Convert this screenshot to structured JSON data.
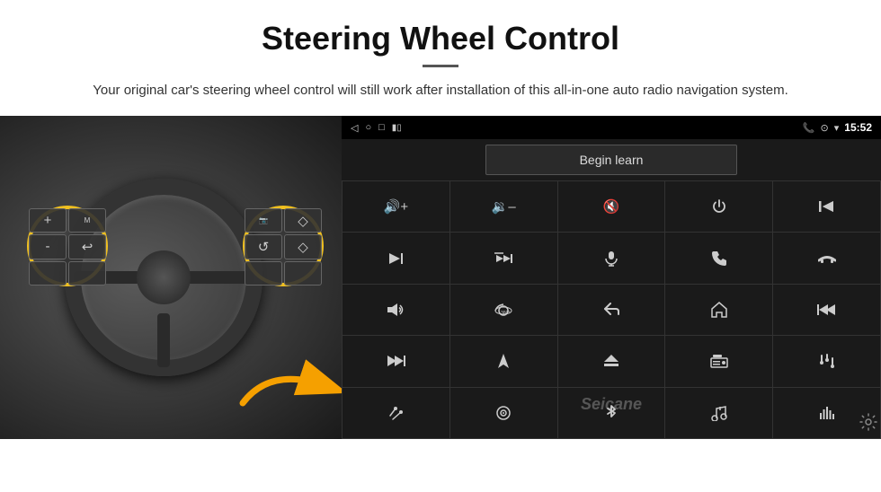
{
  "header": {
    "title": "Steering Wheel Control",
    "subtitle": "Your original car's steering wheel control will still work after installation of this all-in-one auto radio navigation system."
  },
  "status_bar": {
    "time": "15:52",
    "icons": [
      "◁",
      "○",
      "□",
      "📶"
    ]
  },
  "begin_learn": {
    "label": "Begin learn"
  },
  "controls": [
    {
      "icon": "🔊+",
      "label": "vol-up"
    },
    {
      "icon": "🔊-",
      "label": "vol-down"
    },
    {
      "icon": "🔇",
      "label": "mute"
    },
    {
      "icon": "⏻",
      "label": "power"
    },
    {
      "icon": "⏮",
      "label": "prev-track"
    },
    {
      "icon": "⏭",
      "label": "next"
    },
    {
      "icon": "✕⏭",
      "label": "skip"
    },
    {
      "icon": "🎤",
      "label": "mic"
    },
    {
      "icon": "📞",
      "label": "call"
    },
    {
      "icon": "↩",
      "label": "hang-up"
    },
    {
      "icon": "📢",
      "label": "horn"
    },
    {
      "icon": "360°",
      "label": "camera-360"
    },
    {
      "icon": "↺",
      "label": "back"
    },
    {
      "icon": "⌂",
      "label": "home"
    },
    {
      "icon": "⏮⏮",
      "label": "prev"
    },
    {
      "icon": "⏭⏭",
      "label": "fast-forward"
    },
    {
      "icon": "▶",
      "label": "nav"
    },
    {
      "icon": "⏏",
      "label": "eject"
    },
    {
      "icon": "📻",
      "label": "radio"
    },
    {
      "icon": "≡|≡",
      "label": "eq"
    },
    {
      "icon": "🎤",
      "label": "mic2"
    },
    {
      "icon": "⊙",
      "label": "circle"
    },
    {
      "icon": "✱",
      "label": "bluetooth"
    },
    {
      "icon": "🎵",
      "label": "music"
    },
    {
      "icon": "|||",
      "label": "bars"
    }
  ],
  "seicane": {
    "watermark": "Seicane"
  },
  "left_buttons": [
    "+",
    "M",
    "-",
    "↩",
    "",
    ""
  ],
  "right_buttons": [
    "📷",
    "◇",
    "↺",
    "◇",
    "",
    ""
  ]
}
